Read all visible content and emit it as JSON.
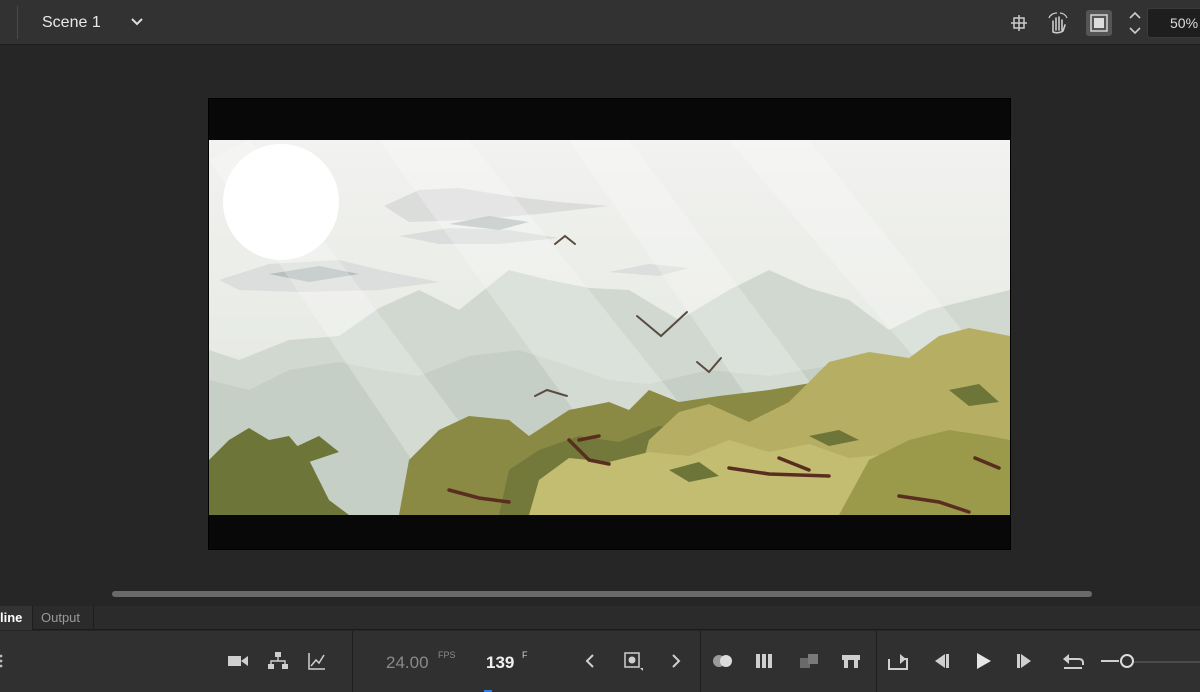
{
  "header": {
    "scene_name": "Scene 1",
    "zoom_value": "50%",
    "tools": [
      "center-stage-icon",
      "rotate-hand-icon",
      "clip-content-icon"
    ]
  },
  "stage": {
    "background_color": "#262626",
    "frame_color": "#080808",
    "sky_color": "#e9ede7",
    "foliage_colors": [
      "#6e7538",
      "#9a9a4a",
      "#c3bd72"
    ],
    "branch_color": "#5a2e1f"
  },
  "panel_tabs": {
    "timeline_label": "line",
    "output_label": "Output"
  },
  "timeline": {
    "fps_value": "24.00",
    "fps_unit": "FPS",
    "frame_value": "139",
    "frame_unit": "F",
    "accent_color": "#2f7fe0"
  }
}
